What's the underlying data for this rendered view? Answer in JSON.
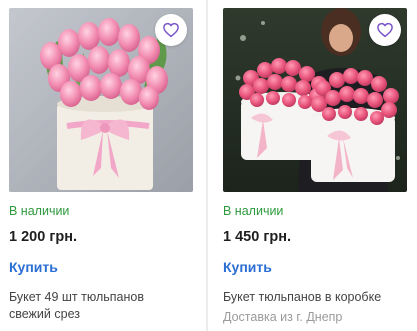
{
  "products": [
    {
      "stock": "В наличии",
      "price": "1 200 грн.",
      "buy_label": "Купить",
      "title_line1": "Букет 49 шт тюльпанов",
      "title_line2": "свежий срез",
      "favorite_icon": "heart-icon"
    },
    {
      "stock": "В наличии",
      "price": "1 450 грн.",
      "buy_label": "Купить",
      "title_line1": "Букет тюльпанов в коробке",
      "delivery": "Доставка из г. Днепр",
      "favorite_icon": "heart-icon"
    }
  ],
  "colors": {
    "stock": "#2e9a3e",
    "buy": "#2b6fd4",
    "heart": "#7a56c9"
  }
}
